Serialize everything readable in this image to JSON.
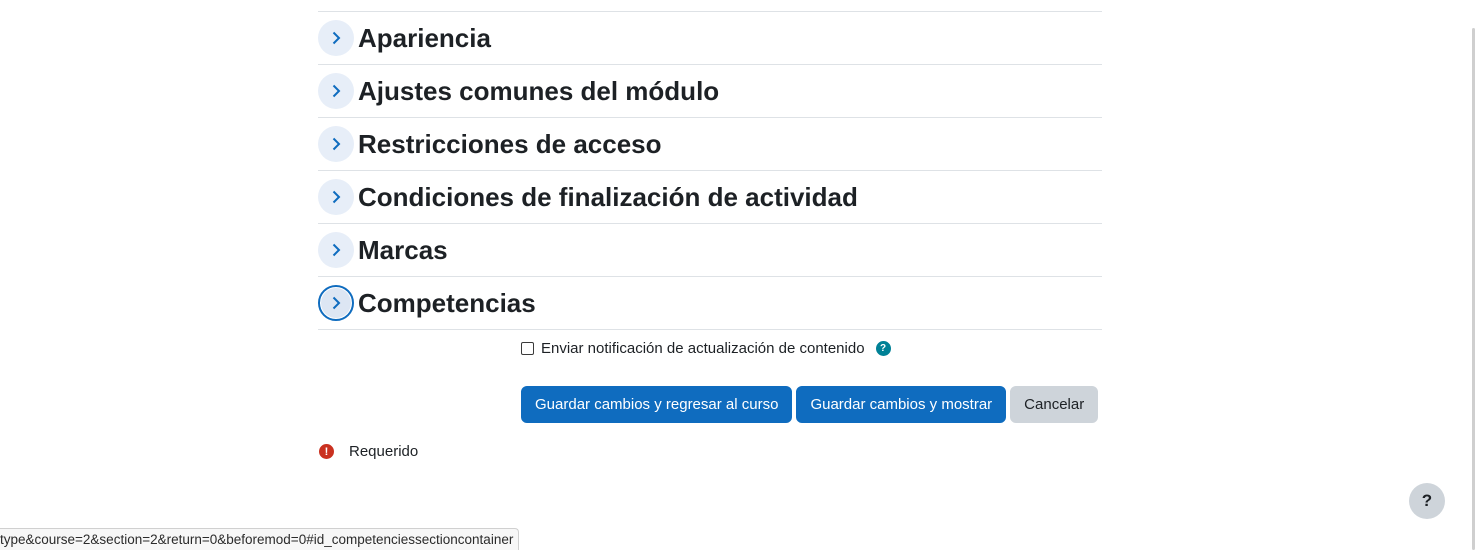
{
  "sections": [
    {
      "title": "Apariencia"
    },
    {
      "title": "Ajustes comunes del módulo"
    },
    {
      "title": "Restricciones de acceso"
    },
    {
      "title": "Condiciones de finalización de actividad"
    },
    {
      "title": "Marcas"
    },
    {
      "title": "Competencias"
    }
  ],
  "notify": {
    "label": "Enviar notificación de actualización de contenido",
    "checked": false,
    "help_icon": "?"
  },
  "buttons": {
    "save_return": "Guardar cambios y regresar al curso",
    "save_display": "Guardar cambios y mostrar",
    "cancel": "Cancelar"
  },
  "required": {
    "icon": "!",
    "label": "Requerido"
  },
  "help_fab": "?",
  "status_bar": {
    "url": "type&course=2&section=2&return=0&beforemod=0#id_competenciessectioncontainer"
  },
  "colors": {
    "primary": "#0f6cbf",
    "secondary": "#ced4da",
    "danger": "#ca3120",
    "info": "#008196"
  }
}
